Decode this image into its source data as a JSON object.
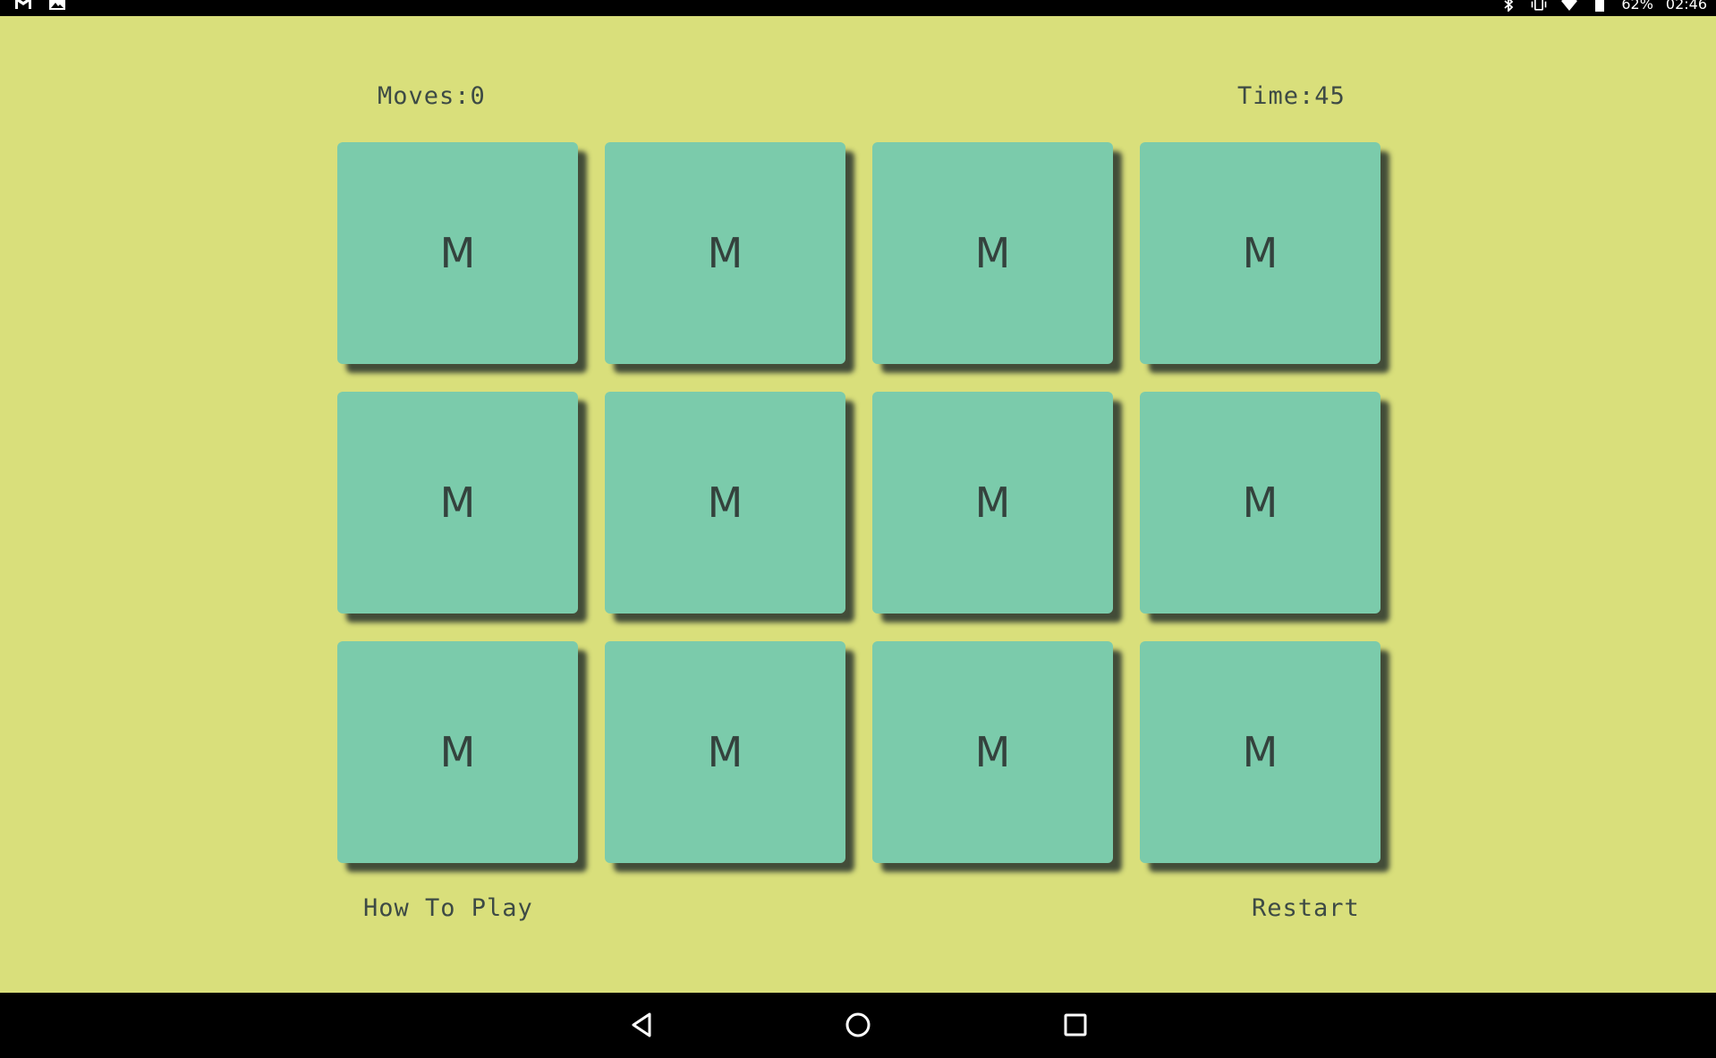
{
  "status_bar": {
    "battery": "62%",
    "time": "02:46",
    "left_icons": [
      "gmail-icon",
      "image-icon"
    ],
    "right_icons": [
      "bluetooth-icon",
      "vibrate-icon",
      "wifi-icon",
      "battery-icon"
    ]
  },
  "game": {
    "moves_label": "Moves:0",
    "time_label": "Time:45",
    "cards": [
      "M",
      "M",
      "M",
      "M",
      "M",
      "M",
      "M",
      "M",
      "M",
      "M",
      "M",
      "M"
    ],
    "how_to_play": "How To Play",
    "restart": "Restart"
  },
  "colors": {
    "background": "#d9df7b",
    "card": "#7bcbab",
    "text": "#3d4a45"
  },
  "nav_bar": {
    "buttons": [
      "back-icon",
      "home-icon",
      "recents-icon"
    ]
  }
}
